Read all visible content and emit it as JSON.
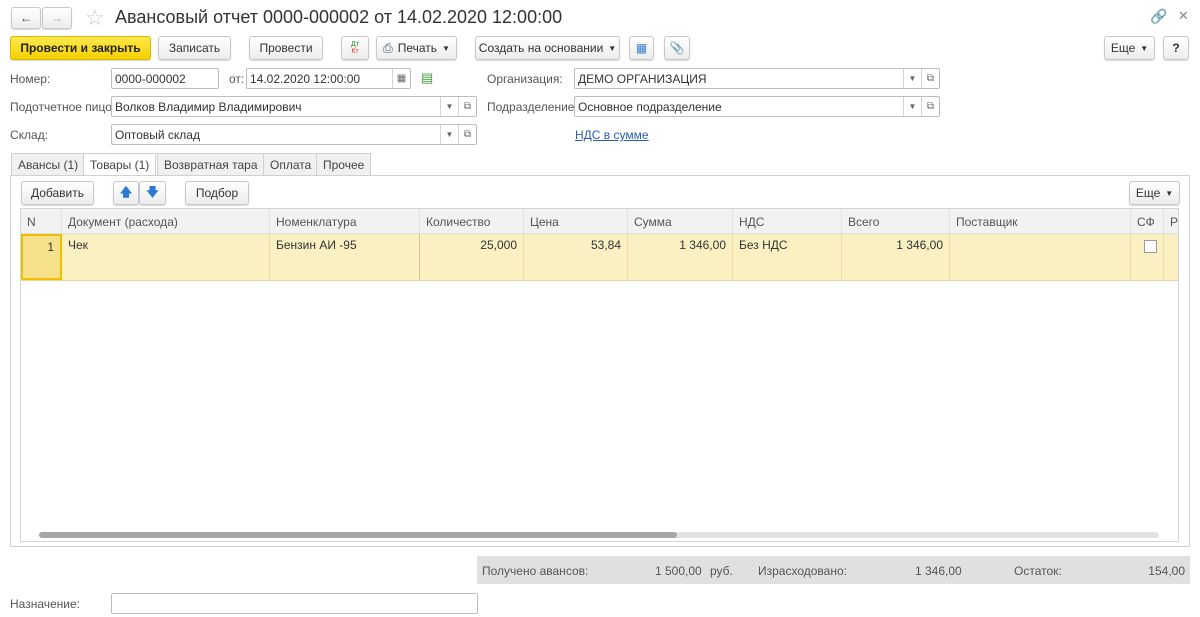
{
  "title": "Авансовый отчет 0000-000002 от 14.02.2020 12:00:00",
  "toolbar": {
    "post_close": "Провести и закрыть",
    "save": "Записать",
    "post": "Провести",
    "dtkt_dt": "Дт",
    "dtkt_kt": "Кт",
    "print": "Печать",
    "create_based": "Создать на основании",
    "more": "Еще",
    "help": "?"
  },
  "form": {
    "number_label": "Номер:",
    "number": "0000-000002",
    "date_label": "от:",
    "date": "14.02.2020 12:00:00",
    "org_label": "Организация:",
    "org": "ДЕМО ОРГАНИЗАЦИЯ",
    "person_label": "Подотчетное пицо:",
    "person": "Волков Владимир Владимирович",
    "dept_label": "Подразделение:",
    "dept": "Основное подразделение",
    "warehouse_label": "Склад:",
    "warehouse": "Оптовый склад",
    "vat_link": "НДС в сумме"
  },
  "tabs": [
    "Авансы (1)",
    "Товары (1)",
    "Возвратная тара",
    "Оплата",
    "Прочее"
  ],
  "table_toolbar": {
    "add": "Добавить",
    "pick": "Подбор",
    "more": "Еще"
  },
  "columns": [
    "N",
    "Документ (расхода)",
    "Номенклатура",
    "Количество",
    "Цена",
    "Сумма",
    "НДС",
    "Всего",
    "Поставщик",
    "СФ",
    "Р"
  ],
  "rows": [
    {
      "n": "1",
      "doc": "Чек",
      "item": "Бензин АИ -95",
      "qty": "25,000",
      "price": "53,84",
      "sum": "1 346,00",
      "vat": "Без НДС",
      "total": "1 346,00",
      "supplier": "",
      "sf": false
    }
  ],
  "totals": {
    "received_label": "Получено авансов:",
    "received": "1 500,00",
    "currency": "руб.",
    "spent_label": "Израсходовано:",
    "spent": "1 346,00",
    "rest_label": "Остаток:",
    "rest": "154,00"
  },
  "purpose_label": "Назначение:",
  "purpose": ""
}
